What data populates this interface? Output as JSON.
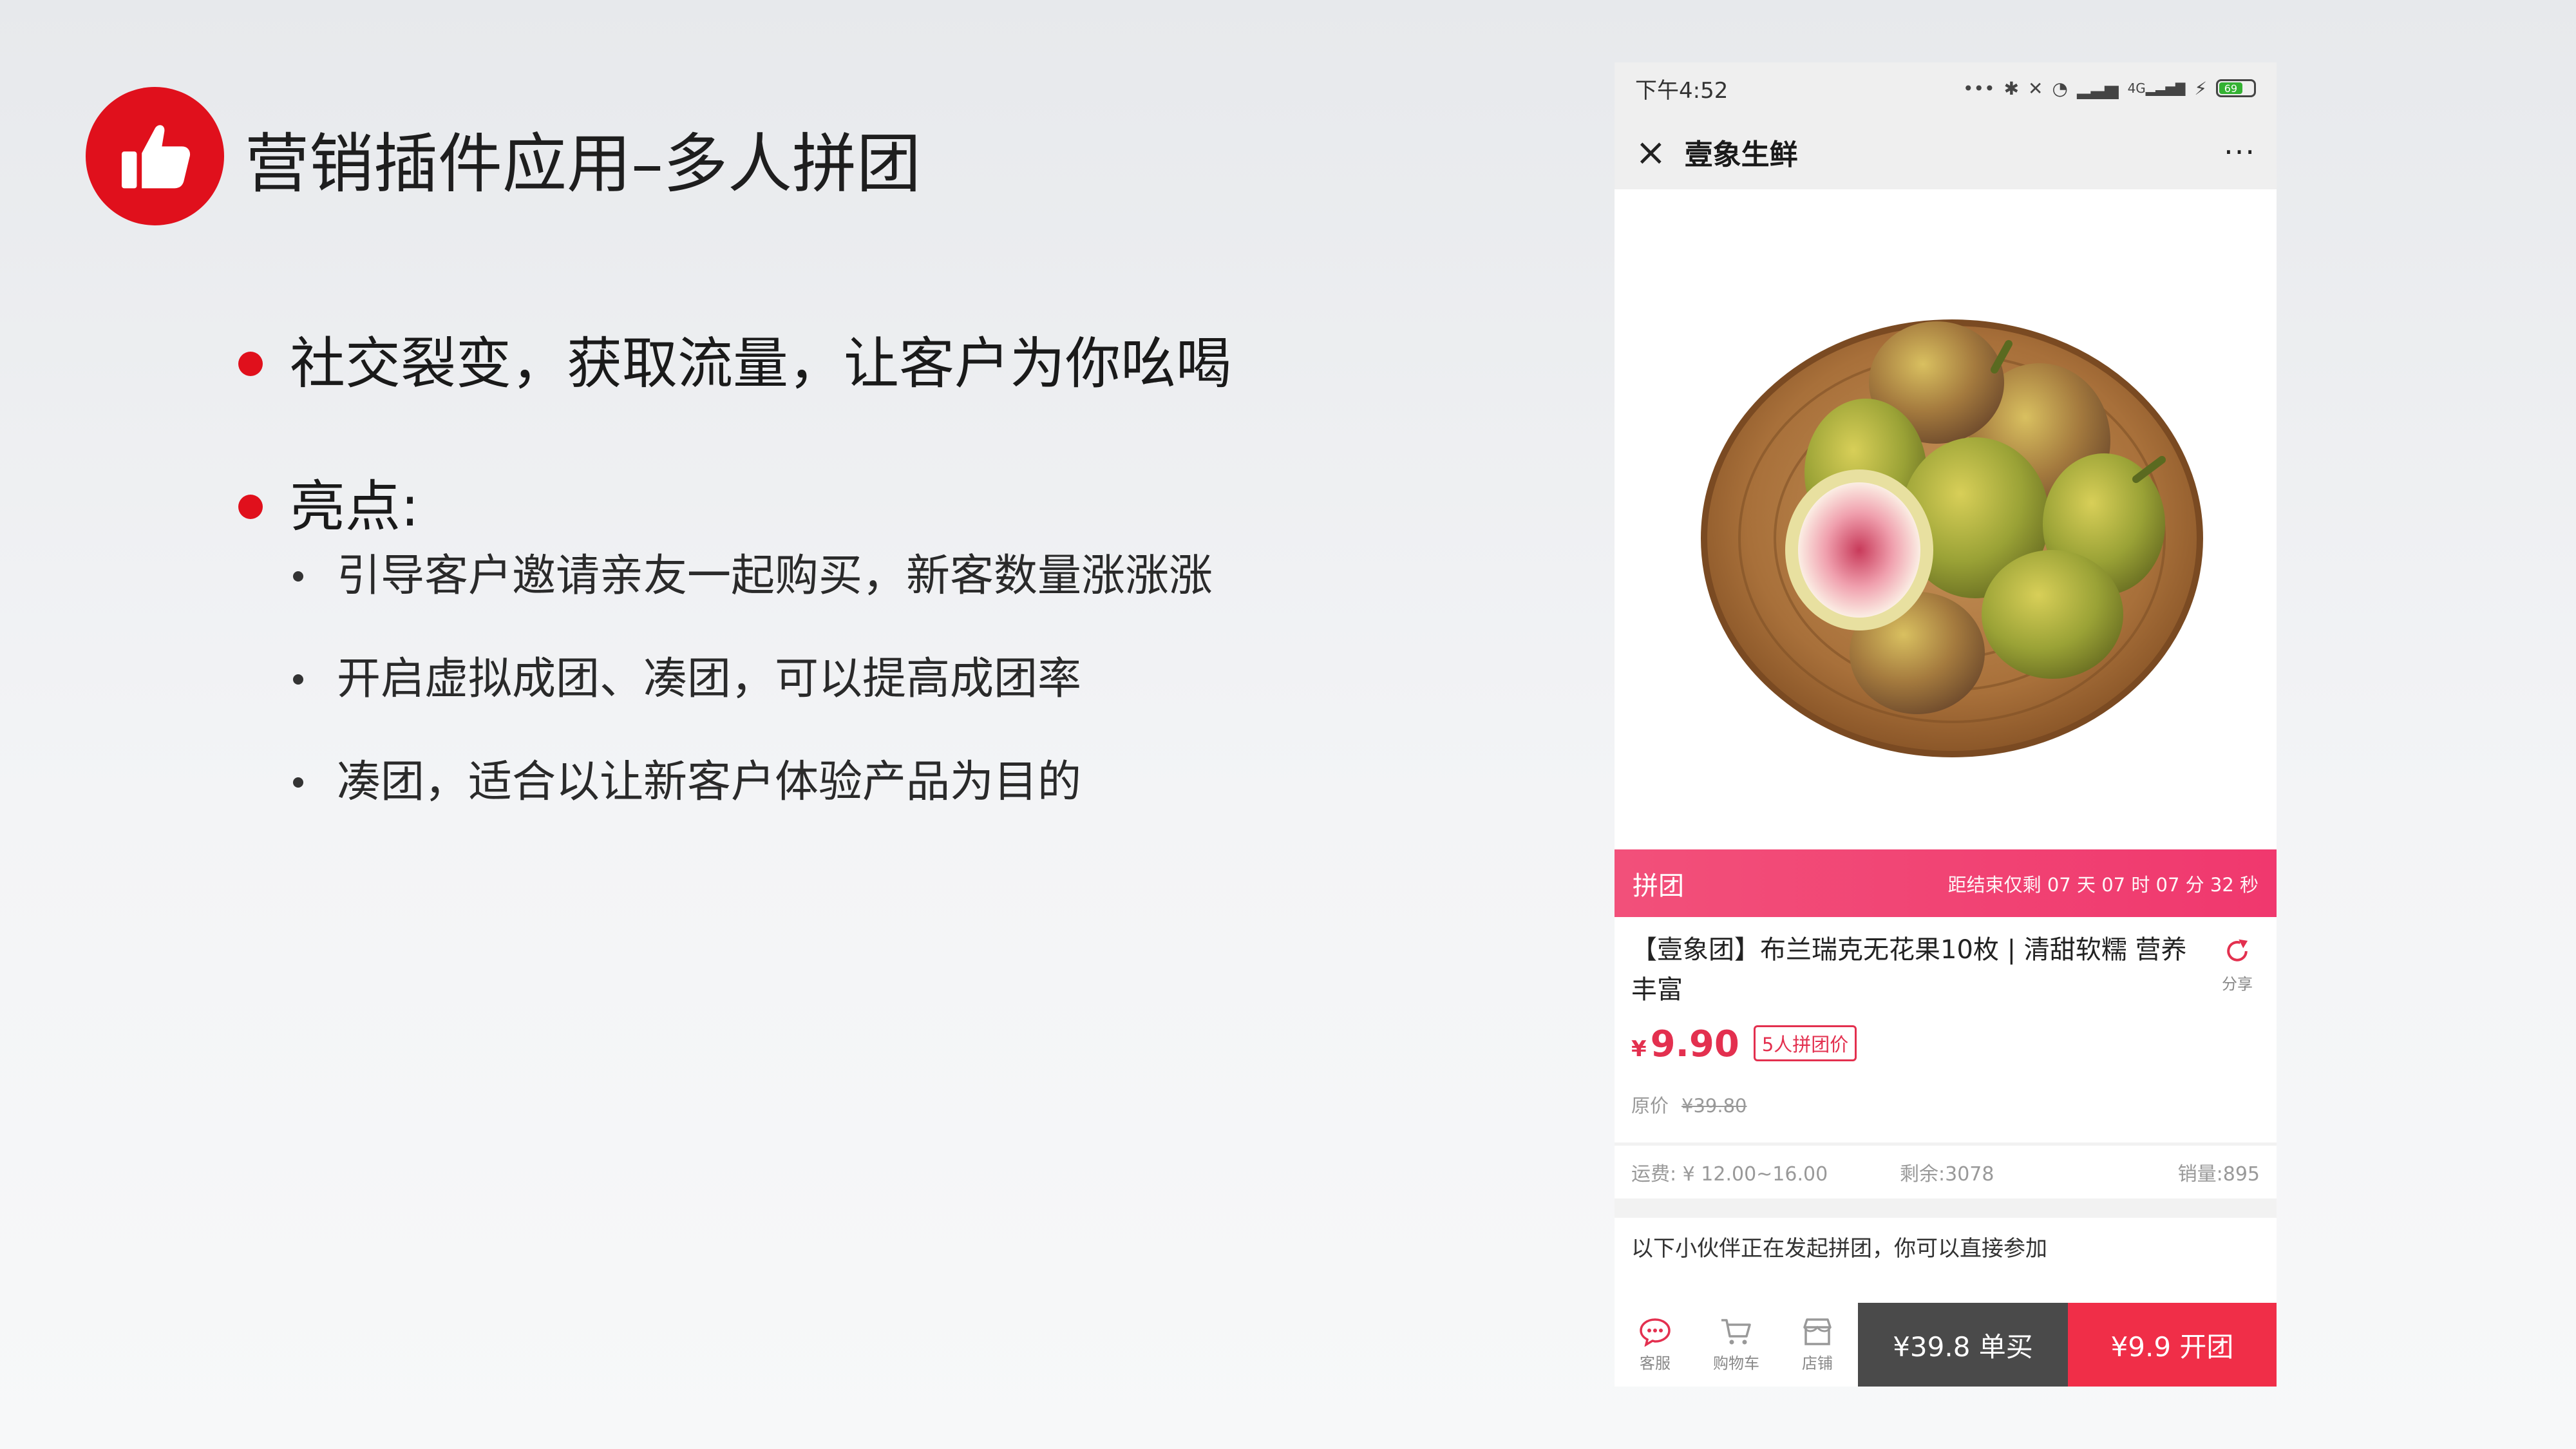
{
  "slide": {
    "title": "营销插件应用–多人拼团",
    "bullet_1": "社交裂变，获取流量，让客户为你吆喝",
    "bullet_2": "亮点:",
    "sub_bullets": [
      "引导客户邀请亲友一起购买，新客数量涨涨涨",
      "开启虚拟成团、凑团，可以提高成团率",
      "凑团，适合以让新客户体验产品为目的"
    ],
    "accent_color": "#e0101c"
  },
  "phone": {
    "status": {
      "time": "下午4:52",
      "signal": "4G",
      "battery": "69"
    },
    "nav": {
      "close_icon": "close-icon",
      "shop_name": "壹象生鲜",
      "more": "···"
    },
    "promo": {
      "label": "拼团",
      "countdown": "距结束仅剩  07 天 07 时 07 分 32 秒",
      "color": "#f0386e"
    },
    "product": {
      "name": "【壹象团】布兰瑞克无花果10枚 | 清甜软糯 营养丰富",
      "share_label": "分享",
      "currency": "¥",
      "price": "9.90",
      "group_tag": "5人拼团价",
      "orig_label": "原价",
      "orig_price": "¥39.80"
    },
    "stats": {
      "shipping": "运费: ¥ 12.00~16.00",
      "remaining": "剩余:3078",
      "sales": "销量:895"
    },
    "group_notice": "以下小伙伴正在发起拼团，你可以直接参加",
    "bottom": {
      "service": "客服",
      "cart": "购物车",
      "store": "店铺",
      "single_buy": "¥39.8 单买",
      "group_buy": "¥9.9 开团"
    }
  }
}
